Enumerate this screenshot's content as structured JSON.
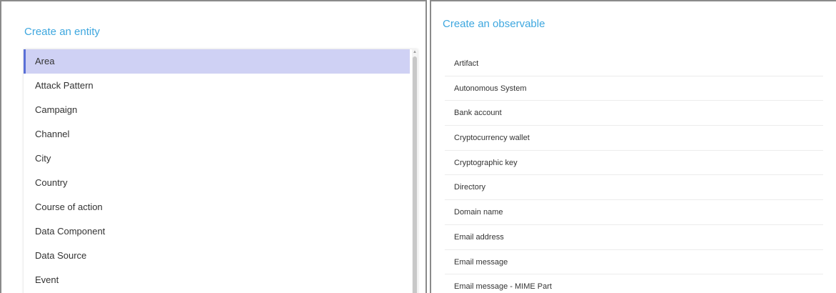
{
  "entity_panel": {
    "title": "Create an entity",
    "items": [
      "Area",
      "Attack Pattern",
      "Campaign",
      "Channel",
      "City",
      "Country",
      "Course of action",
      "Data Component",
      "Data Source",
      "Event"
    ],
    "selected_item": "Area"
  },
  "observable_panel": {
    "title": "Create an observable",
    "items": [
      "Artifact",
      "Autonomous System",
      "Bank account",
      "Cryptocurrency wallet",
      "Cryptographic key",
      "Directory",
      "Domain name",
      "Email address",
      "Email message",
      "Email message - MIME Part"
    ]
  },
  "colors": {
    "title_accent": "#3ea7df",
    "selected_background": "#cfd1f4",
    "selected_indicator": "#5a6fd6"
  },
  "icons": {
    "scroll_up": "scroll-up-arrow-icon"
  }
}
